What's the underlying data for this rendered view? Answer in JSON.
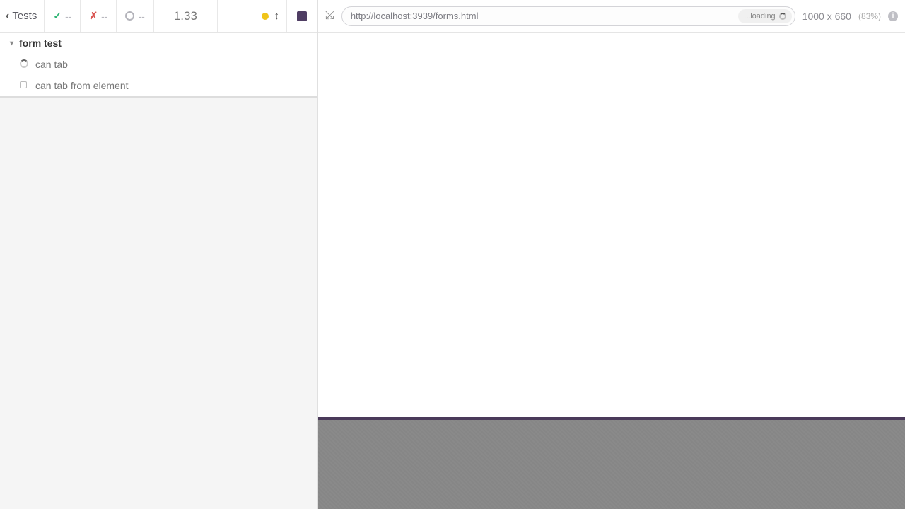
{
  "toolbar": {
    "back_label": "Tests",
    "passed": "--",
    "failed": "--",
    "pending": "--",
    "timer": "1.33"
  },
  "tests": {
    "suite_name": "form test",
    "items": [
      {
        "label": "can tab",
        "state": "running"
      },
      {
        "label": "can tab from element",
        "state": "pending"
      }
    ]
  },
  "urlbar": {
    "url": "http://localhost:3939/forms.html",
    "loading_label": "...loading",
    "viewport": "1000 x 660",
    "scale": "(83%)"
  }
}
